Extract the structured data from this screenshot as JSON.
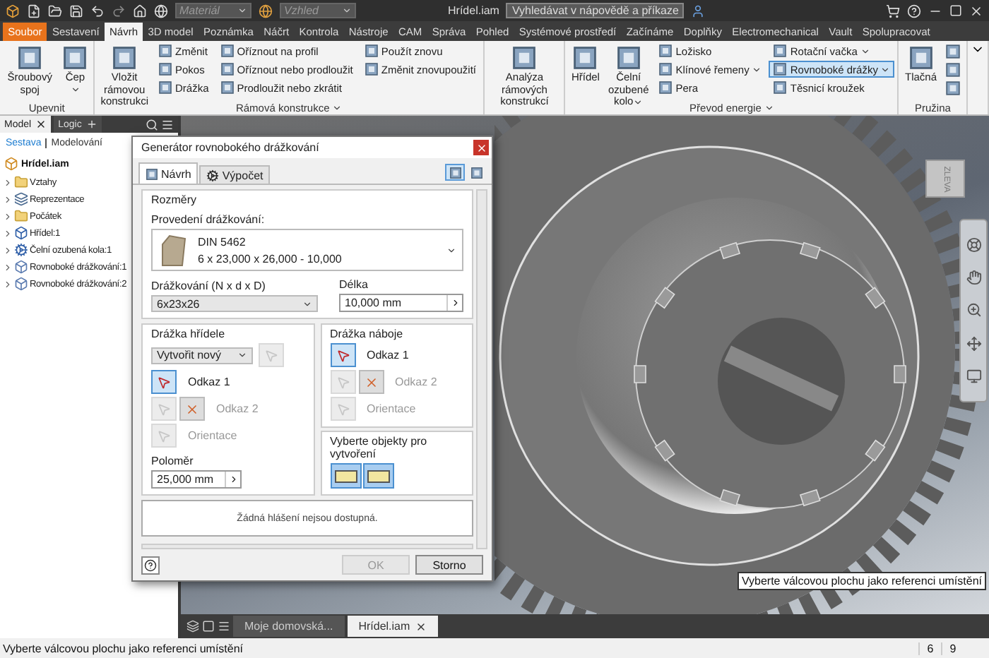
{
  "title_bar": {
    "title": "Hrídel.iam",
    "material": {
      "placeholder": "Materiál"
    },
    "appearance": {
      "placeholder": "Vzhled"
    },
    "search": {
      "placeholder": "Vyhledávat v nápovědě a příkaze"
    }
  },
  "ribbon_tabs": [
    {
      "label": "Soubor",
      "kind": "menu",
      "selected": false
    },
    {
      "label": "Sestavení",
      "kind": "tab",
      "selected": false
    },
    {
      "label": "Návrh",
      "kind": "tab",
      "selected": true
    },
    {
      "label": "3D model",
      "kind": "tab",
      "selected": false
    },
    {
      "label": "Poznámka",
      "kind": "tab",
      "selected": false
    },
    {
      "label": "Náčrt",
      "kind": "tab",
      "selected": false
    },
    {
      "label": "Kontrola",
      "kind": "tab",
      "selected": false
    },
    {
      "label": "Nástroje",
      "kind": "tab",
      "selected": false
    },
    {
      "label": "CAM",
      "kind": "tab",
      "selected": false
    },
    {
      "label": "Správa",
      "kind": "tab",
      "selected": false
    },
    {
      "label": "Pohled",
      "kind": "tab",
      "selected": false
    },
    {
      "label": "Systémové prostředí",
      "kind": "tab",
      "selected": false
    },
    {
      "label": "Začínáme",
      "kind": "tab",
      "selected": false
    },
    {
      "label": "Doplňky",
      "kind": "tab",
      "selected": false
    },
    {
      "label": "Electromechanical",
      "kind": "tab",
      "selected": false
    },
    {
      "label": "Vault",
      "kind": "tab",
      "selected": false
    },
    {
      "label": "Spolupracovat",
      "kind": "tab",
      "selected": false
    }
  ],
  "ribbon_groups": [
    {
      "title": "Upevnit",
      "dropdown": false,
      "columns": [
        [
          {
            "label": "Šroubový spoj",
            "kind": "large",
            "selected": false
          }
        ],
        [
          {
            "label": "Čep",
            "kind": "large",
            "selected": false,
            "dropdown": true
          }
        ]
      ]
    },
    {
      "title": "Rámová konstrukce",
      "dropdown": true,
      "columns": [
        [
          {
            "label": "Vložit rámovou konstrukci",
            "kind": "large",
            "selected": false
          }
        ],
        [
          {
            "label": "Změnit",
            "kind": "small",
            "selected": false
          },
          {
            "label": "Pokos",
            "kind": "small",
            "selected": false
          },
          {
            "label": "Drážka",
            "kind": "small",
            "selected": false
          }
        ],
        [
          {
            "label": "Oříznout na profil",
            "kind": "small",
            "selected": false
          },
          {
            "label": "Oříznout nebo prodloužit",
            "kind": "small",
            "selected": false
          },
          {
            "label": "Prodloužit nebo zkrátit",
            "kind": "small",
            "selected": false
          }
        ],
        [
          {
            "label": "Použít znovu",
            "kind": "small",
            "selected": false
          },
          {
            "label": "Změnit znovupoužití",
            "kind": "small",
            "selected": false
          }
        ]
      ]
    },
    {
      "columns": [
        [
          {
            "label": "Analýza rámových konstrukcí",
            "kind": "large",
            "selected": false
          }
        ]
      ]
    },
    {
      "title": "Převod energie",
      "dropdown": true,
      "columns": [
        [
          {
            "label": "Hřídel",
            "kind": "large",
            "selected": false
          }
        ],
        [
          {
            "label": "Čelní ozubené kolo",
            "kind": "large",
            "selected": false,
            "dropdown": true
          }
        ],
        [
          {
            "label": "Ložisko",
            "kind": "small",
            "selected": false
          },
          {
            "label": "Klínové řemeny",
            "kind": "small",
            "selected": false,
            "dropdown": true
          },
          {
            "label": "Pera",
            "kind": "small",
            "selected": false
          }
        ],
        [
          {
            "label": "Rotační vačka",
            "kind": "small",
            "selected": false,
            "dropdown": true
          },
          {
            "label": "Rovnoboké drážky",
            "kind": "small",
            "selected": true,
            "dropdown": true
          },
          {
            "label": "Těsnicí kroužek",
            "kind": "small",
            "selected": false
          }
        ]
      ]
    },
    {
      "title": "Pružina",
      "dropdown": false,
      "columns": [
        [
          {
            "label": "Tlačná",
            "kind": "large",
            "selected": false
          }
        ],
        [
          {
            "kind": "icon",
            "selected": false
          },
          {
            "kind": "icon",
            "selected": false
          },
          {
            "kind": "icon",
            "selected": false
          }
        ]
      ]
    }
  ],
  "browser": {
    "tabs": [
      {
        "label": "Model",
        "selected": true,
        "kind": "close"
      },
      {
        "label": "Logic",
        "selected": false,
        "kind": "add"
      }
    ],
    "modes": [
      {
        "label": "Sestava",
        "selected": true
      },
      {
        "label": "Modelování",
        "selected": false
      }
    ],
    "tree": {
      "label": "Hrídel.iam",
      "children": [
        {
          "label": "Vztahy",
          "kind": "folder",
          "expanded": false
        },
        {
          "label": "Reprezentace",
          "kind": "representation",
          "expanded": false
        },
        {
          "label": "Počátek",
          "kind": "folder",
          "expanded": false
        },
        {
          "label": "Hřídel:1",
          "kind": "shaft",
          "expanded": false
        },
        {
          "label": "Čelní ozubená kola:1",
          "kind": "gear",
          "expanded": false
        },
        {
          "label": "Rovnoboké drážkování:1",
          "kind": "spline",
          "expanded": false
        },
        {
          "label": "Rovnoboké drážkování:2",
          "kind": "spline",
          "expanded": false
        }
      ]
    }
  },
  "dialog": {
    "title": "Generátor rovnobokého drážkování",
    "tabs": [
      {
        "label": "Návrh",
        "selected": true
      },
      {
        "label": "Výpočet",
        "selected": false
      }
    ],
    "toolbar": [
      {
        "selected": true
      },
      {
        "selected": false
      }
    ],
    "dimensions": {
      "title": "Rozměry",
      "type_label": "Provedení drážkování:",
      "type_lines": [
        "DIN 5462",
        "6 x 23,000 x 26,000 - 10,000"
      ],
      "spline_label": "Drážkování (N x d x D)",
      "spline_value": "6x23x26",
      "length_label": "Délka",
      "length_value": "10,000 mm"
    },
    "shaft_groove": {
      "title": "Drážka hřídele",
      "mode_value": "Vytvořit nový",
      "references": [
        {
          "label": "Odkaz 1",
          "kind": "pick",
          "disabled": false,
          "selected": true
        },
        {
          "label": "Odkaz 2",
          "kind": "pick_flip",
          "disabled": true,
          "selected": false
        },
        {
          "label": "Orientace",
          "kind": "pick",
          "disabled": true,
          "selected": false
        }
      ],
      "radius_label": "Poloměr",
      "radius_value": "25,000 mm"
    },
    "hub_groove": {
      "title": "Drážka náboje",
      "references": [
        {
          "label": "Odkaz 1",
          "kind": "pick",
          "disabled": false,
          "selected": true
        },
        {
          "label": "Odkaz 2",
          "kind": "pick_flip",
          "disabled": true,
          "selected": false
        },
        {
          "label": "Orientace",
          "kind": "pick",
          "disabled": true,
          "selected": false
        }
      ]
    },
    "create_objects": {
      "title": "Vyberte objekty pro vytvoření",
      "options": [
        {
          "selected": true
        },
        {
          "selected": true
        }
      ]
    },
    "messages": "Žádná hlášení nejsou dostupná.",
    "buttons": [
      {
        "label": "OK",
        "disabled": true
      },
      {
        "label": "Storno",
        "disabled": false
      }
    ]
  },
  "viewcube": {
    "label": "ZLEVA"
  },
  "tooltip": "Vyberte válcovou plochu jako referenci umístění",
  "document_tabs": [
    {
      "label": "Moje domovská...",
      "selected": false,
      "closable": false
    },
    {
      "label": "Hrídel.iam",
      "selected": true,
      "closable": true
    }
  ],
  "status_bar": {
    "message": "Vyberte válcovou plochu jako referenci umístění",
    "fields": [
      "6",
      "9"
    ]
  }
}
